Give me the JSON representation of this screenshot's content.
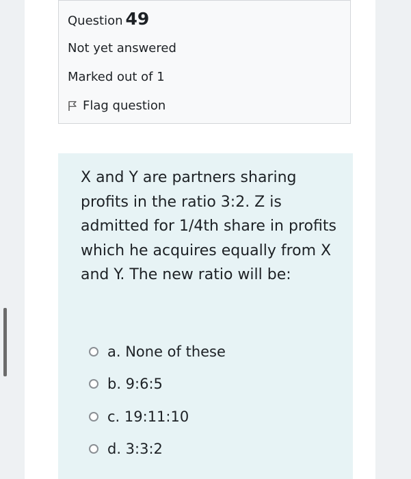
{
  "question_info": {
    "label": "Question",
    "number": "49",
    "state": "Not yet answered",
    "grade": "Marked out of 1",
    "flag_label": "Flag question"
  },
  "question": {
    "text": "X and Y are partners sharing profits in the ratio 3:2. Z is admitted for 1/4th share in profits which he acquires equally from X and Y. The new ratio will be:"
  },
  "answers": [
    {
      "label": "a. None of these"
    },
    {
      "label": "b. 9:6:5"
    },
    {
      "label": "c. 19:11:10"
    },
    {
      "label": "d. 3:3:2"
    }
  ],
  "colors": {
    "info_background": "#f8f9fa",
    "content_background": "#e7f3f5",
    "page_background": "#eef1f3",
    "text": "#1d2125"
  }
}
